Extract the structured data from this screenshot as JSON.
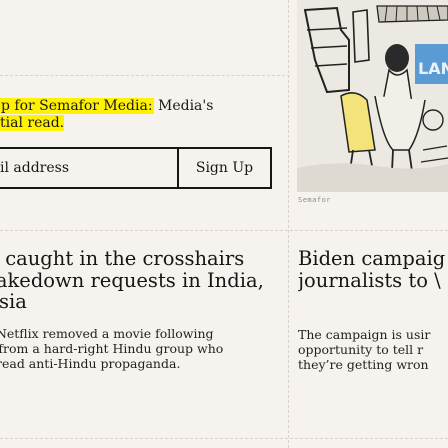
{
  "newsletter": {
    "prompt_clip": "p for Semafor Media:",
    "prompt_tail": "Media's",
    "prompt_line2": "tial read.",
    "email_placeholder": "il address",
    "signup_label": "Sign Up"
  },
  "photo": {
    "caption": "Semafor",
    "sign_text": "LAN"
  },
  "articles": [
    {
      "headline_lines": [
        "x caught in the crosshairs",
        "takedown requests in India,",
        "ysia"
      ],
      "dek_lines": [
        ", Netflix removed a movie following",
        "s from a hard-right Hindu group who",
        "pread anti-Hindu propaganda."
      ]
    },
    {
      "headline_lines": [
        "Biden campaig",
        "journalists to \\"
      ],
      "dek_lines": [
        "The campaign is usir",
        "opportunity to tell r",
        "they’re getting wron"
      ]
    }
  ],
  "colors": {
    "background": "#f6f3ee",
    "highlight": "#fff200",
    "ink": "#161616"
  }
}
